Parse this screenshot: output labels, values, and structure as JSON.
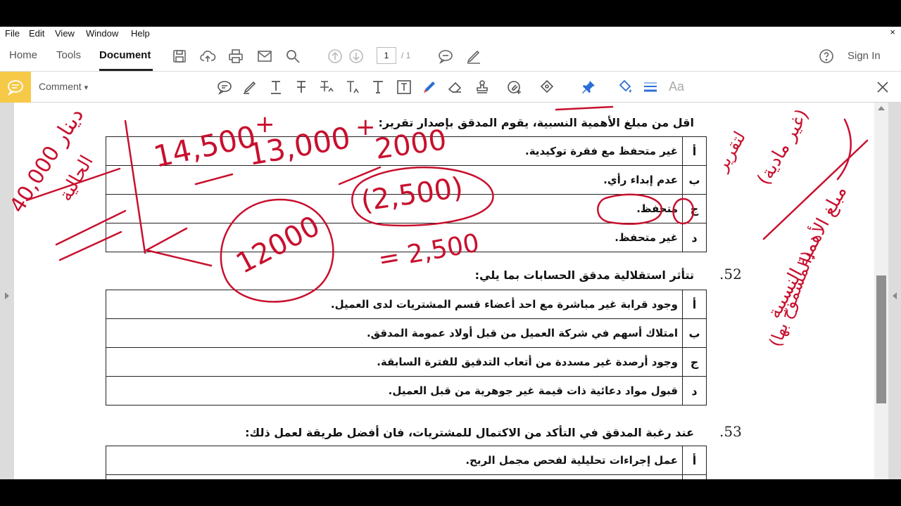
{
  "menu": {
    "items": [
      "File",
      "Edit",
      "View",
      "Window",
      "Help"
    ],
    "close": "×"
  },
  "app_toolbar": {
    "nav": {
      "home": "Home",
      "tools": "Tools",
      "document": "Document"
    },
    "page_current": "1",
    "page_total": "/ 1",
    "sign_in": "Sign In",
    "icons": [
      "save-icon",
      "upload-icon",
      "print-icon",
      "email-icon",
      "search-icon",
      "page-up-icon",
      "page-down-icon",
      "comment-bubble-icon",
      "pen-sign-icon",
      "help-icon"
    ]
  },
  "comment_toolbar": {
    "label": "Comment",
    "dropdown": "▾",
    "aa_label": "Aa",
    "icons": [
      "sticky-note-icon",
      "highlight-icon",
      "text-underline-icon",
      "strikethrough-icon",
      "replace-text-icon",
      "insert-text-icon",
      "add-text-icon",
      "text-box-icon",
      "draw-pencil-icon",
      "eraser-icon",
      "stamp-icon",
      "attach-icon",
      "shapes-icon",
      "pin-icon",
      "fill-color-icon",
      "line-weight-icon"
    ],
    "accent_color": "#f7c948"
  },
  "document": {
    "intro_text": "اقل من مبلغ الأهمية النسبية، يقوم المدقق بإصدار تقرير:",
    "q51_options": [
      {
        "letter": "أ",
        "text": "غير متحفظ مع فقرة توكيدية."
      },
      {
        "letter": "ب",
        "text": "عدم إبداء رأي."
      },
      {
        "letter": "ج",
        "text": "متحفظ."
      },
      {
        "letter": "د",
        "text": "غير متحفظ."
      }
    ],
    "q52": {
      "number": ".52",
      "text": "تتأثر استقلالية مدقق الحسابات بما يلي:",
      "options": [
        {
          "letter": "أ",
          "text": "وجود قرابة غير مباشرة مع احد أعضاء قسم المشتريات لدى العميل."
        },
        {
          "letter": "ب",
          "text": "امتلاك أسهم في شركة العميل من قبل أولاد عمومة المدقق."
        },
        {
          "letter": "ج",
          "text": "وجود أرصدة غير مسددة من أتعاب التدقيق للفترة السابقة."
        },
        {
          "letter": "د",
          "text": "قبول مواد دعائية ذات قيمة غير جوهرية من قبل العميل."
        }
      ]
    },
    "q53": {
      "number": ".53",
      "text": "عند رغبة المدقق في التأكد من الاكتمال للمشتريات، فان أفضل طريقة لعمل ذلك:",
      "options": [
        {
          "letter": "أ",
          "text": "عمل إجراءات تحليلية لفحص مجمل الربح."
        }
      ]
    }
  },
  "annotations": {
    "ink_color": "#c8102e",
    "left_notes": [
      "40,000 دينار",
      "الحالية"
    ],
    "numbers": [
      "14,500",
      "+",
      "13,000",
      "+",
      "2000",
      "(2,500)",
      "12000",
      "= 2,500"
    ],
    "right_notes": [
      "مبلغ الأهمية النسبية",
      "(المسموح بها)",
      "(غير مادية)",
      "لتقرير"
    ]
  }
}
